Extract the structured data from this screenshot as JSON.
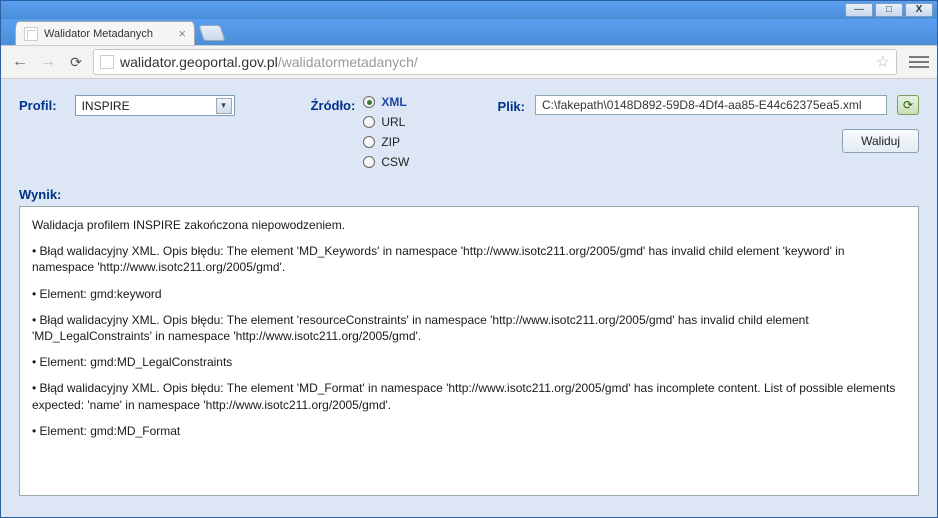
{
  "window": {
    "minimize": "—",
    "maximize": "□",
    "close": "X"
  },
  "browser": {
    "tab_title": "Walidator Metadanych",
    "url_host": "walidator.geoportal.gov.pl",
    "url_path": "/walidatormetadanych/"
  },
  "form": {
    "profile_label": "Profil:",
    "profile_value": "INSPIRE",
    "source_label": "Źródło:",
    "source_options": {
      "xml": "XML",
      "url": "URL",
      "zip": "ZIP",
      "csw": "CSW"
    },
    "source_selected": "xml",
    "file_label": "Plik:",
    "file_value": "C:\\fakepath\\0148D892-59D8-4Df4-aa85-E44c62375ea5.xml",
    "validate_label": "Waliduj"
  },
  "result": {
    "label": "Wynik:",
    "lines": {
      "l0": "Walidacja profilem INSPIRE zakończona niepowodzeniem.",
      "l1": "• Błąd walidacyjny XML. Opis błędu: The element 'MD_Keywords' in namespace 'http://www.isotc211.org/2005/gmd' has invalid child element 'keyword' in namespace 'http://www.isotc211.org/2005/gmd'.",
      "l2": "• Element: gmd:keyword",
      "l3": "• Błąd walidacyjny XML. Opis błędu: The element 'resourceConstraints' in namespace 'http://www.isotc211.org/2005/gmd' has invalid child element 'MD_LegalConstraints' in namespace 'http://www.isotc211.org/2005/gmd'.",
      "l4": "• Element: gmd:MD_LegalConstraints",
      "l5": "• Błąd walidacyjny XML. Opis błędu: The element 'MD_Format' in namespace 'http://www.isotc211.org/2005/gmd' has incomplete content. List of possible elements expected: 'name' in namespace 'http://www.isotc211.org/2005/gmd'.",
      "l6": "• Element: gmd:MD_Format"
    }
  }
}
